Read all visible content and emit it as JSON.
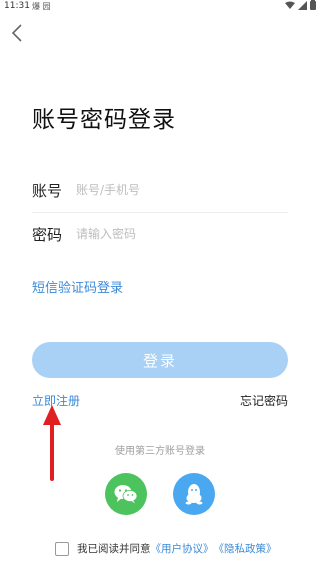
{
  "status_bar": {
    "time": "11:31",
    "notif_text": "爆 园"
  },
  "page": {
    "title": "账号密码登录"
  },
  "form": {
    "account_label": "账号",
    "account_placeholder": "账号/手机号",
    "password_label": "密码",
    "password_placeholder": "请输入密码"
  },
  "links": {
    "sms_login": "短信验证码登录",
    "register": "立即注册",
    "forgot_password": "忘记密码"
  },
  "login_button": {
    "label": "登录",
    "color": "#a9d0f5"
  },
  "third_party": {
    "label": "使用第三方账号登录",
    "providers": [
      {
        "name": "wechat",
        "icon": "wechat-icon",
        "color": "#4cc35c"
      },
      {
        "name": "qq",
        "icon": "qq-icon",
        "color": "#4aa8f0"
      }
    ]
  },
  "agreement": {
    "prefix": "我已阅读并同意",
    "user_agreement": "《用户协议》",
    "privacy_policy": "《隐私政策》"
  },
  "annotation": {
    "arrow_color": "#e02020"
  }
}
